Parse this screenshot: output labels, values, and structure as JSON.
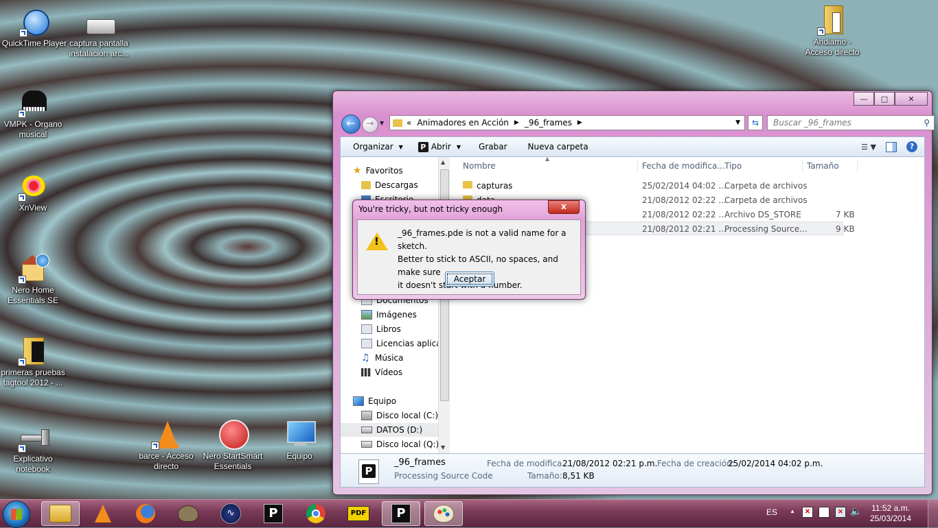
{
  "desktop": {
    "icons": [
      {
        "label": "QuickTime Player"
      },
      {
        "label": "captura pantalla instalacion arc..."
      },
      {
        "label": "VMPK - Organo musical"
      },
      {
        "label": "XnView"
      },
      {
        "label": "Nero Home Essentials SE"
      },
      {
        "label": "primeras pruebas tagtool 2012 - ..."
      },
      {
        "label": "Explicativo notebook"
      },
      {
        "label": "barce - Acceso directo"
      },
      {
        "label": "Nero StartSmart Essentials"
      },
      {
        "label": "Equipo"
      },
      {
        "label": "Andiamo - Acceso directo"
      }
    ]
  },
  "explorer": {
    "address": {
      "prefix": "«",
      "segments": [
        "Animadores en Acción",
        "_96_frames"
      ]
    },
    "search_placeholder": "Buscar _96_frames",
    "toolbar": {
      "organize": "Organizar",
      "open": "Abrir",
      "burn": "Grabar",
      "new_folder": "Nueva carpeta"
    },
    "nav": {
      "favorites": "Favoritos",
      "downloads": "Descargas",
      "desktop_partial": "Escritorio",
      "documents": "Documentos",
      "images": "Imágenes",
      "books": "Libros",
      "licenses": "Licencias aplicati",
      "music": "Música",
      "videos": "Vídeos",
      "computer": "Equipo",
      "disk_c": "Disco local (C:)",
      "datos_d": "DATOS (D:)",
      "disk_q": "Disco local (Q:)"
    },
    "columns": {
      "name": "Nombre",
      "date": "Fecha de modifica...",
      "type": "Tipo",
      "size": "Tamaño"
    },
    "rows": [
      {
        "name": "capturas",
        "date": "25/02/2014 04:02 ...",
        "type": "Carpeta de archivos",
        "size": ""
      },
      {
        "name": "data",
        "date": "21/08/2012 02:22 ...",
        "type": "Carpeta de archivos",
        "size": ""
      },
      {
        "name": "",
        "date": "21/08/2012 02:22 ...",
        "type": "Archivo DS_STORE",
        "size": "7 KB"
      },
      {
        "name": "",
        "date": "21/08/2012 02:21 ...",
        "type": "Processing Source...",
        "size": "9 KB"
      }
    ],
    "details": {
      "name": "_96_frames",
      "kind": "Processing Source Code",
      "modified_label": "Fecha de modifica...",
      "modified_value": "21/08/2012 02:21 p.m.",
      "created_label": "Fecha de creación:",
      "created_value": "25/02/2014 04:02 p.m.",
      "size_label": "Tamaño:",
      "size_value": "8,51 KB"
    }
  },
  "dialog": {
    "title": "You're tricky, but not tricky enough",
    "message_lines": [
      "_96_frames.pde is not a valid name for a sketch.",
      "Better to stick to ASCII, no spaces, and make sure",
      "it doesn't start with a number."
    ],
    "ok": "Aceptar",
    "close_glyph": "x"
  },
  "taskbar": {
    "lang": "ES",
    "time": "11:52 a.m.",
    "date": "25/03/2014",
    "pdf_label": "PDF",
    "p_label": "P"
  },
  "icons": [
    "folder-icon",
    "vlc-icon",
    "firefox-icon",
    "gimp-icon",
    "processing-icon",
    "chrome-icon",
    "pdf-icon",
    "paint-icon",
    "warning-icon",
    "search-icon",
    "star-icon"
  ]
}
